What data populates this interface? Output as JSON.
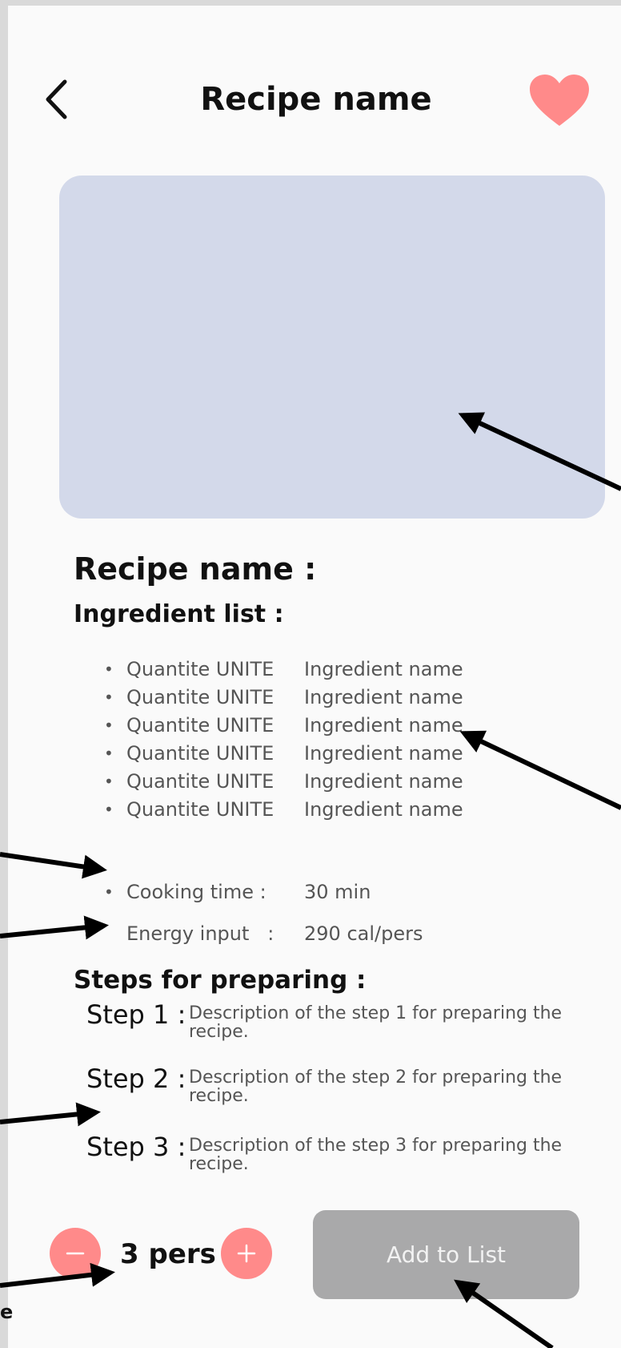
{
  "header": {
    "title": "Recipe name",
    "back_icon": "chevron-left-icon",
    "favorite_icon": "heart-icon",
    "accent_color": "#ff8a8a"
  },
  "hero_image": {
    "placeholder_color": "#d3d9ea"
  },
  "details": {
    "recipe_title": "Recipe name :",
    "ingredients_heading": "Ingredient list :",
    "ingredients": [
      {
        "quantity": "Quantite UNITE",
        "name": "Ingredient name"
      },
      {
        "quantity": "Quantite UNITE",
        "name": "Ingredient name"
      },
      {
        "quantity": "Quantite UNITE",
        "name": "Ingredient name"
      },
      {
        "quantity": "Quantite UNITE",
        "name": "Ingredient name"
      },
      {
        "quantity": "Quantite UNITE",
        "name": "Ingredient name"
      },
      {
        "quantity": "Quantite UNITE",
        "name": "Ingredient name"
      }
    ],
    "cooking_time": {
      "label": "Cooking time :",
      "value": "30 min"
    },
    "energy": {
      "label": "Energy input   :",
      "value": "290 cal/pers"
    }
  },
  "steps": {
    "heading": "Steps for preparing :",
    "items": [
      {
        "label": "Step 1 :",
        "description": "Description of the step 1 for preparing the recipe."
      },
      {
        "label": "Step 2 :",
        "description": "Description of the step 2 for preparing the recipe."
      },
      {
        "label": "Step 3 :",
        "description": "Description of the step 3 for preparing the recipe."
      }
    ]
  },
  "footer": {
    "minus_icon": "minus-icon",
    "plus_icon": "plus-icon",
    "people_count": "3 pers",
    "add_button_label": "Add to List",
    "add_button_color": "#a9a9aa"
  },
  "annotations": {
    "partial_text": "e"
  }
}
